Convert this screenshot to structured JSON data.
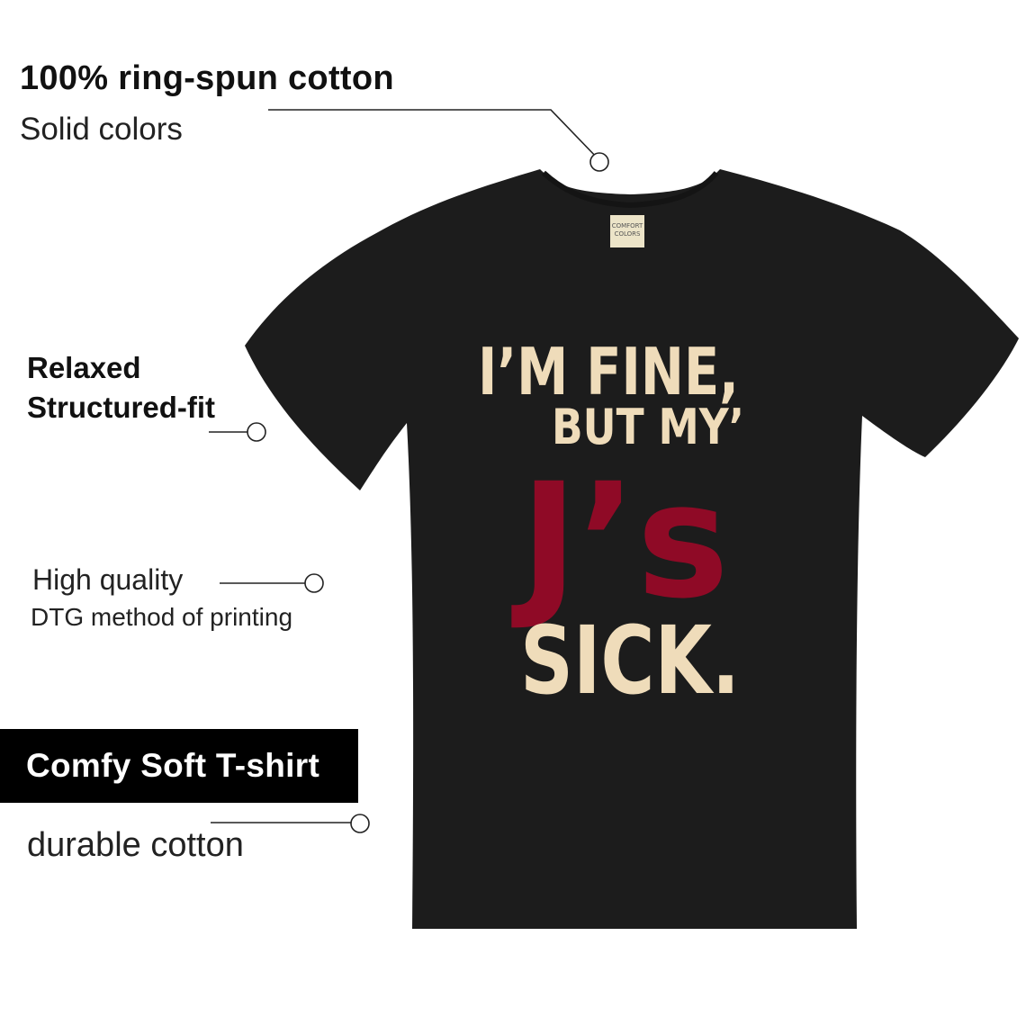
{
  "features": {
    "material": {
      "title": "100% ring-spun cotton",
      "subtitle": "Solid colors"
    },
    "fit": {
      "title": "Relaxed",
      "subtitle": "Structured-fit"
    },
    "print": {
      "title": "High quality",
      "subtitle": "DTG method of printing"
    },
    "badge": {
      "label": "Comfy Soft T-shirt"
    },
    "durability": {
      "subtitle": "durable cotton"
    }
  },
  "shirt": {
    "color": "#1c1c1c",
    "tag_text": [
      "COMFORT",
      "COLORS"
    ],
    "graphic": {
      "line1": "I’M FINE,",
      "line2": "BUT MY’",
      "line3": "J’s",
      "line4": "SICK.",
      "cream": "#efdcba",
      "red": "#8f0a26"
    }
  }
}
